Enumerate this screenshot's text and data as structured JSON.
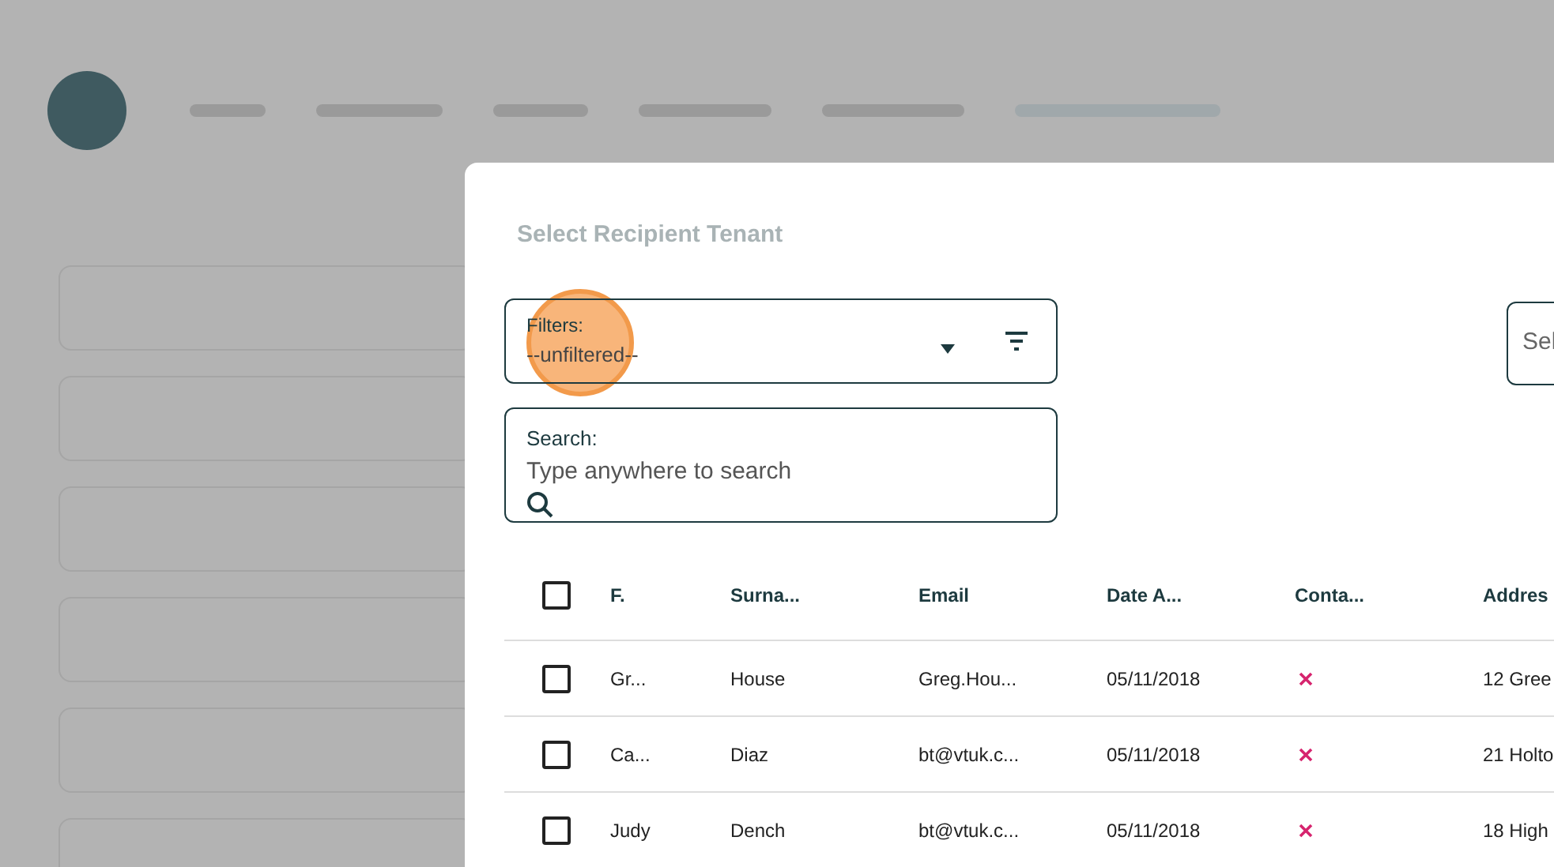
{
  "dialog": {
    "title": "Select Recipient Tenant",
    "filters": {
      "label": "Filters:",
      "value": "--unfiltered--"
    },
    "search": {
      "label": "Search:",
      "placeholder": "Type anywhere to search"
    },
    "select_field": {
      "placeholder": "Sel"
    },
    "table": {
      "select_all": {
        "checked": false
      },
      "columns": [
        "F.",
        "Surna...",
        "Email",
        "Date A...",
        "Conta...",
        "Addres"
      ],
      "rows": [
        {
          "checked": false,
          "first": "Gr...",
          "surname": "House",
          "email": "Greg.Hou...",
          "date": "05/11/2018",
          "contact": false,
          "address": "12 Gree"
        },
        {
          "checked": false,
          "first": "Ca...",
          "surname": "Diaz",
          "email": "bt@vtuk.c...",
          "date": "05/11/2018",
          "contact": false,
          "address": "21 Holto"
        },
        {
          "checked": false,
          "first": "Judy",
          "surname": "Dench",
          "email": "bt@vtuk.c...",
          "date": "05/11/2018",
          "contact": false,
          "address": "18 High"
        }
      ]
    }
  }
}
